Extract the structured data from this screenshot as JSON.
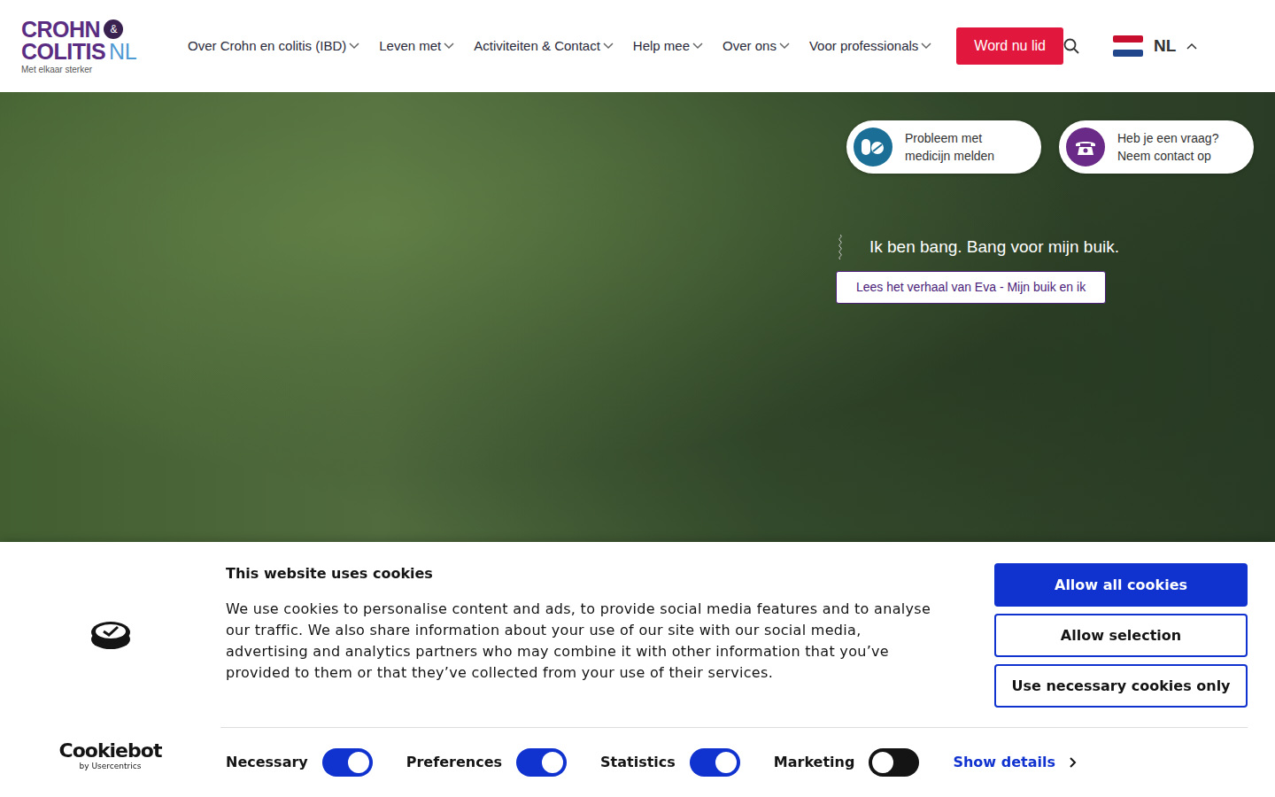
{
  "logo": {
    "line1": "CROHN",
    "amp": "&",
    "line2": "COLITIS",
    "suffix": "NL",
    "tagline": "Met elkaar sterker"
  },
  "nav": {
    "items": [
      {
        "label": "Over Crohn en colitis (IBD)",
        "expanded": false
      },
      {
        "label": "Leven met",
        "expanded": false
      },
      {
        "label": "Activiteiten & Contact",
        "expanded": false
      },
      {
        "label": "Help mee",
        "expanded": false
      },
      {
        "label": "Over ons",
        "expanded": false
      },
      {
        "label": "Voor professionals",
        "expanded": false
      }
    ]
  },
  "join_button": "Word nu lid",
  "language": {
    "code": "NL",
    "expanded": true
  },
  "quick_links": [
    {
      "kind": "medicine",
      "lines": [
        "Probleem met",
        "medicijn melden"
      ]
    },
    {
      "kind": "contact",
      "lines": [
        "Heb je een vraag?",
        "Neem contact op"
      ]
    }
  ],
  "hero": {
    "quote": "Ik ben bang. Bang voor mijn buik.",
    "button": "Lees het verhaal van Eva - Mijn buik en ik"
  },
  "cookie_banner": {
    "title": "This website uses cookies",
    "body": "We use cookies to personalise content and ads, to provide social media features and to analyse our traffic. We also share information about your use of our site with our social media, advertising and analytics partners who may combine it with other information that you’ve provided to them or that they’ve collected from your use of their services.",
    "buttons": [
      {
        "label": "Allow all cookies",
        "kind": "primary"
      },
      {
        "label": "Allow selection",
        "kind": "outline"
      },
      {
        "label": "Use necessary cookies only",
        "kind": "outline"
      }
    ],
    "toggles": [
      {
        "label": "Necessary",
        "on": true
      },
      {
        "label": "Preferences",
        "on": true
      },
      {
        "label": "Statistics",
        "on": true
      },
      {
        "label": "Marketing",
        "on": false
      }
    ],
    "details": "Show details",
    "brand": "Cookiebot",
    "brand_sub": "by Usercentrics"
  }
}
